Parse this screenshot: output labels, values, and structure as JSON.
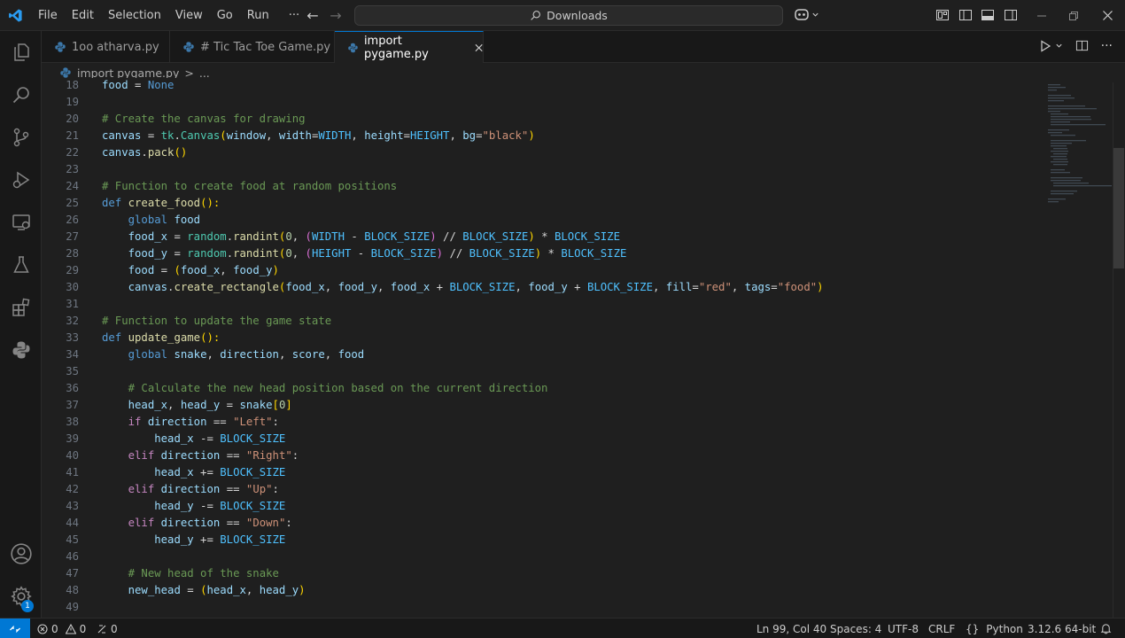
{
  "titlebar": {
    "menu": [
      "File",
      "Edit",
      "Selection",
      "View",
      "Go",
      "Run",
      "···"
    ],
    "command_center": "Downloads"
  },
  "tabs": [
    {
      "label": "1oo atharva.py",
      "active": false
    },
    {
      "label": "# Tic Tac Toe Game.py",
      "active": false
    },
    {
      "label": "import pygame.py",
      "active": true
    }
  ],
  "breadcrumb": {
    "file": "import pygame.py",
    "sep": ">",
    "rest": "..."
  },
  "editor": {
    "lines": [
      {
        "n": "18",
        "t": [
          [
            "food",
            "v"
          ],
          [
            " = ",
            "t"
          ],
          [
            "None",
            "k"
          ]
        ]
      },
      {
        "n": "19",
        "t": []
      },
      {
        "n": "20",
        "t": [
          [
            "# Create the canvas for drawing",
            "c"
          ]
        ]
      },
      {
        "n": "21",
        "t": [
          [
            "canvas",
            "v"
          ],
          [
            " = ",
            "t"
          ],
          [
            "tk",
            "cl"
          ],
          [
            ".",
            "t"
          ],
          [
            "Canvas",
            "cl"
          ],
          [
            "(",
            "b1"
          ],
          [
            "window",
            "v"
          ],
          [
            ", ",
            "t"
          ],
          [
            "width",
            "v"
          ],
          [
            "=",
            "t"
          ],
          [
            "WIDTH",
            "co"
          ],
          [
            ", ",
            "t"
          ],
          [
            "height",
            "v"
          ],
          [
            "=",
            "t"
          ],
          [
            "HEIGHT",
            "co"
          ],
          [
            ", ",
            "t"
          ],
          [
            "bg",
            "v"
          ],
          [
            "=",
            "t"
          ],
          [
            "\"black\"",
            "s"
          ],
          [
            ")",
            "b1"
          ]
        ]
      },
      {
        "n": "22",
        "t": [
          [
            "canvas",
            "v"
          ],
          [
            ".",
            "t"
          ],
          [
            "pack",
            "f"
          ],
          [
            "()",
            "b1"
          ]
        ]
      },
      {
        "n": "23",
        "t": []
      },
      {
        "n": "24",
        "t": [
          [
            "# Function to create food at random positions",
            "c"
          ]
        ]
      },
      {
        "n": "25",
        "t": [
          [
            "def",
            "k"
          ],
          [
            " ",
            "t"
          ],
          [
            "create_food",
            "f"
          ],
          [
            "():",
            "b1"
          ]
        ]
      },
      {
        "n": "26",
        "t": [
          [
            "    ",
            "t"
          ],
          [
            "global",
            "k"
          ],
          [
            " ",
            "t"
          ],
          [
            "food",
            "v"
          ]
        ]
      },
      {
        "n": "27",
        "t": [
          [
            "    ",
            "t"
          ],
          [
            "food_x",
            "v"
          ],
          [
            " = ",
            "t"
          ],
          [
            "random",
            "cl"
          ],
          [
            ".",
            "t"
          ],
          [
            "randint",
            "f"
          ],
          [
            "(",
            "b1"
          ],
          [
            "0",
            "n"
          ],
          [
            ", ",
            "t"
          ],
          [
            "(",
            "b2"
          ],
          [
            "WIDTH",
            "co"
          ],
          [
            " - ",
            "t"
          ],
          [
            "BLOCK_SIZE",
            "co"
          ],
          [
            ")",
            "b2"
          ],
          [
            " // ",
            "t"
          ],
          [
            "BLOCK_SIZE",
            "co"
          ],
          [
            ")",
            "b1"
          ],
          [
            " * ",
            "t"
          ],
          [
            "BLOCK_SIZE",
            "co"
          ]
        ]
      },
      {
        "n": "28",
        "t": [
          [
            "    ",
            "t"
          ],
          [
            "food_y",
            "v"
          ],
          [
            " = ",
            "t"
          ],
          [
            "random",
            "cl"
          ],
          [
            ".",
            "t"
          ],
          [
            "randint",
            "f"
          ],
          [
            "(",
            "b1"
          ],
          [
            "0",
            "n"
          ],
          [
            ", ",
            "t"
          ],
          [
            "(",
            "b2"
          ],
          [
            "HEIGHT",
            "co"
          ],
          [
            " - ",
            "t"
          ],
          [
            "BLOCK_SIZE",
            "co"
          ],
          [
            ")",
            "b2"
          ],
          [
            " // ",
            "t"
          ],
          [
            "BLOCK_SIZE",
            "co"
          ],
          [
            ")",
            "b1"
          ],
          [
            " * ",
            "t"
          ],
          [
            "BLOCK_SIZE",
            "co"
          ]
        ]
      },
      {
        "n": "29",
        "t": [
          [
            "    ",
            "t"
          ],
          [
            "food",
            "v"
          ],
          [
            " = ",
            "t"
          ],
          [
            "(",
            "b1"
          ],
          [
            "food_x",
            "v"
          ],
          [
            ", ",
            "t"
          ],
          [
            "food_y",
            "v"
          ],
          [
            ")",
            "b1"
          ]
        ]
      },
      {
        "n": "30",
        "t": [
          [
            "    ",
            "t"
          ],
          [
            "canvas",
            "v"
          ],
          [
            ".",
            "t"
          ],
          [
            "create_rectangle",
            "f"
          ],
          [
            "(",
            "b1"
          ],
          [
            "food_x",
            "v"
          ],
          [
            ", ",
            "t"
          ],
          [
            "food_y",
            "v"
          ],
          [
            ", ",
            "t"
          ],
          [
            "food_x",
            "v"
          ],
          [
            " + ",
            "t"
          ],
          [
            "BLOCK_SIZE",
            "co"
          ],
          [
            ", ",
            "t"
          ],
          [
            "food_y",
            "v"
          ],
          [
            " + ",
            "t"
          ],
          [
            "BLOCK_SIZE",
            "co"
          ],
          [
            ", ",
            "t"
          ],
          [
            "fill",
            "v"
          ],
          [
            "=",
            "t"
          ],
          [
            "\"red\"",
            "s"
          ],
          [
            ", ",
            "t"
          ],
          [
            "tags",
            "v"
          ],
          [
            "=",
            "t"
          ],
          [
            "\"food\"",
            "s"
          ],
          [
            ")",
            "b1"
          ]
        ]
      },
      {
        "n": "31",
        "t": []
      },
      {
        "n": "32",
        "t": [
          [
            "# Function to update the game state",
            "c"
          ]
        ]
      },
      {
        "n": "33",
        "t": [
          [
            "def",
            "k"
          ],
          [
            " ",
            "t"
          ],
          [
            "update_game",
            "f"
          ],
          [
            "():",
            "b1"
          ]
        ]
      },
      {
        "n": "34",
        "t": [
          [
            "    ",
            "t"
          ],
          [
            "global",
            "k"
          ],
          [
            " ",
            "t"
          ],
          [
            "snake",
            "v"
          ],
          [
            ", ",
            "t"
          ],
          [
            "direction",
            "v"
          ],
          [
            ", ",
            "t"
          ],
          [
            "score",
            "v"
          ],
          [
            ", ",
            "t"
          ],
          [
            "food",
            "v"
          ]
        ]
      },
      {
        "n": "35",
        "t": []
      },
      {
        "n": "36",
        "t": [
          [
            "    ",
            "t"
          ],
          [
            "# Calculate the new head position based on the current direction",
            "c"
          ]
        ]
      },
      {
        "n": "37",
        "t": [
          [
            "    ",
            "t"
          ],
          [
            "head_x",
            "v"
          ],
          [
            ", ",
            "t"
          ],
          [
            "head_y",
            "v"
          ],
          [
            " = ",
            "t"
          ],
          [
            "snake",
            "v"
          ],
          [
            "[",
            "b1"
          ],
          [
            "0",
            "n"
          ],
          [
            "]",
            "b1"
          ]
        ]
      },
      {
        "n": "38",
        "t": [
          [
            "    ",
            "t"
          ],
          [
            "if",
            "ct"
          ],
          [
            " ",
            "t"
          ],
          [
            "direction",
            "v"
          ],
          [
            " == ",
            "t"
          ],
          [
            "\"Left\"",
            "s"
          ],
          [
            ":",
            "t"
          ]
        ]
      },
      {
        "n": "39",
        "t": [
          [
            "        ",
            "t"
          ],
          [
            "head_x",
            "v"
          ],
          [
            " -= ",
            "t"
          ],
          [
            "BLOCK_SIZE",
            "co"
          ]
        ]
      },
      {
        "n": "40",
        "t": [
          [
            "    ",
            "t"
          ],
          [
            "elif",
            "ct"
          ],
          [
            " ",
            "t"
          ],
          [
            "direction",
            "v"
          ],
          [
            " == ",
            "t"
          ],
          [
            "\"Right\"",
            "s"
          ],
          [
            ":",
            "t"
          ]
        ]
      },
      {
        "n": "41",
        "t": [
          [
            "        ",
            "t"
          ],
          [
            "head_x",
            "v"
          ],
          [
            " += ",
            "t"
          ],
          [
            "BLOCK_SIZE",
            "co"
          ]
        ]
      },
      {
        "n": "42",
        "t": [
          [
            "    ",
            "t"
          ],
          [
            "elif",
            "ct"
          ],
          [
            " ",
            "t"
          ],
          [
            "direction",
            "v"
          ],
          [
            " == ",
            "t"
          ],
          [
            "\"Up\"",
            "s"
          ],
          [
            ":",
            "t"
          ]
        ]
      },
      {
        "n": "43",
        "t": [
          [
            "        ",
            "t"
          ],
          [
            "head_y",
            "v"
          ],
          [
            " -= ",
            "t"
          ],
          [
            "BLOCK_SIZE",
            "co"
          ]
        ]
      },
      {
        "n": "44",
        "t": [
          [
            "    ",
            "t"
          ],
          [
            "elif",
            "ct"
          ],
          [
            " ",
            "t"
          ],
          [
            "direction",
            "v"
          ],
          [
            " == ",
            "t"
          ],
          [
            "\"Down\"",
            "s"
          ],
          [
            ":",
            "t"
          ]
        ]
      },
      {
        "n": "45",
        "t": [
          [
            "        ",
            "t"
          ],
          [
            "head_y",
            "v"
          ],
          [
            " += ",
            "t"
          ],
          [
            "BLOCK_SIZE",
            "co"
          ]
        ]
      },
      {
        "n": "46",
        "t": []
      },
      {
        "n": "47",
        "t": [
          [
            "    ",
            "t"
          ],
          [
            "# New head of the snake",
            "c"
          ]
        ]
      },
      {
        "n": "48",
        "t": [
          [
            "    ",
            "t"
          ],
          [
            "new_head",
            "v"
          ],
          [
            " = ",
            "t"
          ],
          [
            "(",
            "b1"
          ],
          [
            "head_x",
            "v"
          ],
          [
            ", ",
            "t"
          ],
          [
            "head_y",
            "v"
          ],
          [
            ")",
            "b1"
          ]
        ]
      },
      {
        "n": "49",
        "t": []
      }
    ]
  },
  "statusbar": {
    "errors": "0",
    "warnings": "0",
    "ports": "0",
    "position": "Ln 99, Col 40",
    "spaces": "Spaces: 4",
    "encoding": "UTF-8",
    "eol": "CRLF",
    "braces": "{}",
    "language": "Python",
    "interpreter": "3.12.6 64-bit"
  },
  "colors": {
    "accent": "#0078d4"
  }
}
